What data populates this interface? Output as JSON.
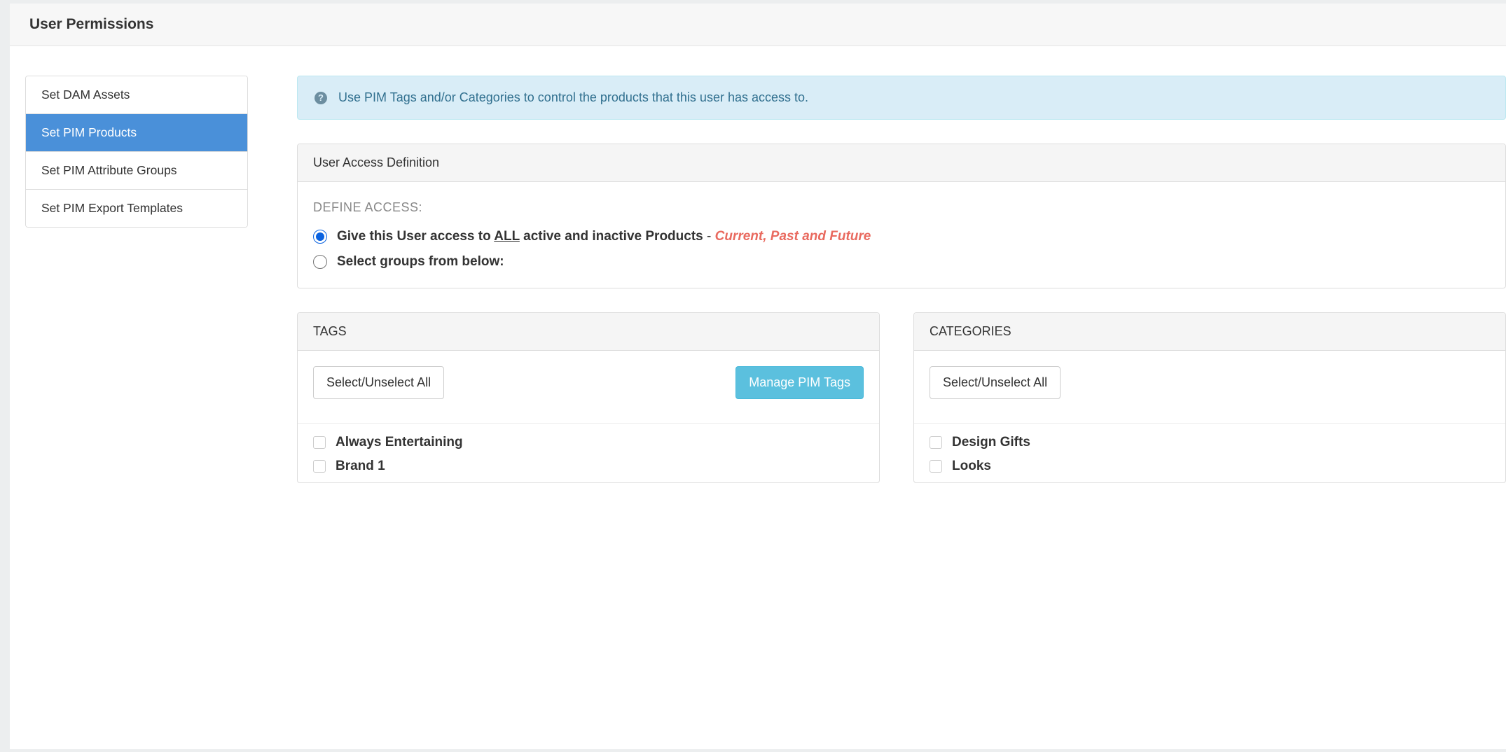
{
  "header": {
    "title": "User Permissions"
  },
  "sidebar": {
    "items": [
      {
        "label": "Set DAM Assets",
        "active": false
      },
      {
        "label": "Set PIM Products",
        "active": true
      },
      {
        "label": "Set PIM Attribute Groups",
        "active": false
      },
      {
        "label": "Set PIM Export Templates",
        "active": false
      }
    ]
  },
  "alert": {
    "text": "Use PIM Tags and/or Categories to control the products that this user has access to."
  },
  "access_panel": {
    "title": "User Access Definition",
    "define_label": "DEFINE ACCESS:",
    "radios": {
      "all_prefix": "Give this User access to",
      "all_underlined": "ALL",
      "all_suffix": "active and inactive Products",
      "note_dash": " - ",
      "note_em": "Current, Past and Future",
      "select_below": "Select groups from below:"
    },
    "selected": "all"
  },
  "tags_panel": {
    "title": "TAGS",
    "select_unselect_label": "Select/Unselect All",
    "manage_label": "Manage PIM Tags",
    "items": [
      {
        "label": "Always Entertaining",
        "checked": false
      },
      {
        "label": "Brand 1",
        "checked": false
      }
    ]
  },
  "categories_panel": {
    "title": "CATEGORIES",
    "select_unselect_label": "Select/Unselect All",
    "items": [
      {
        "label": "Design Gifts",
        "checked": false
      },
      {
        "label": "Looks",
        "checked": false
      }
    ]
  }
}
